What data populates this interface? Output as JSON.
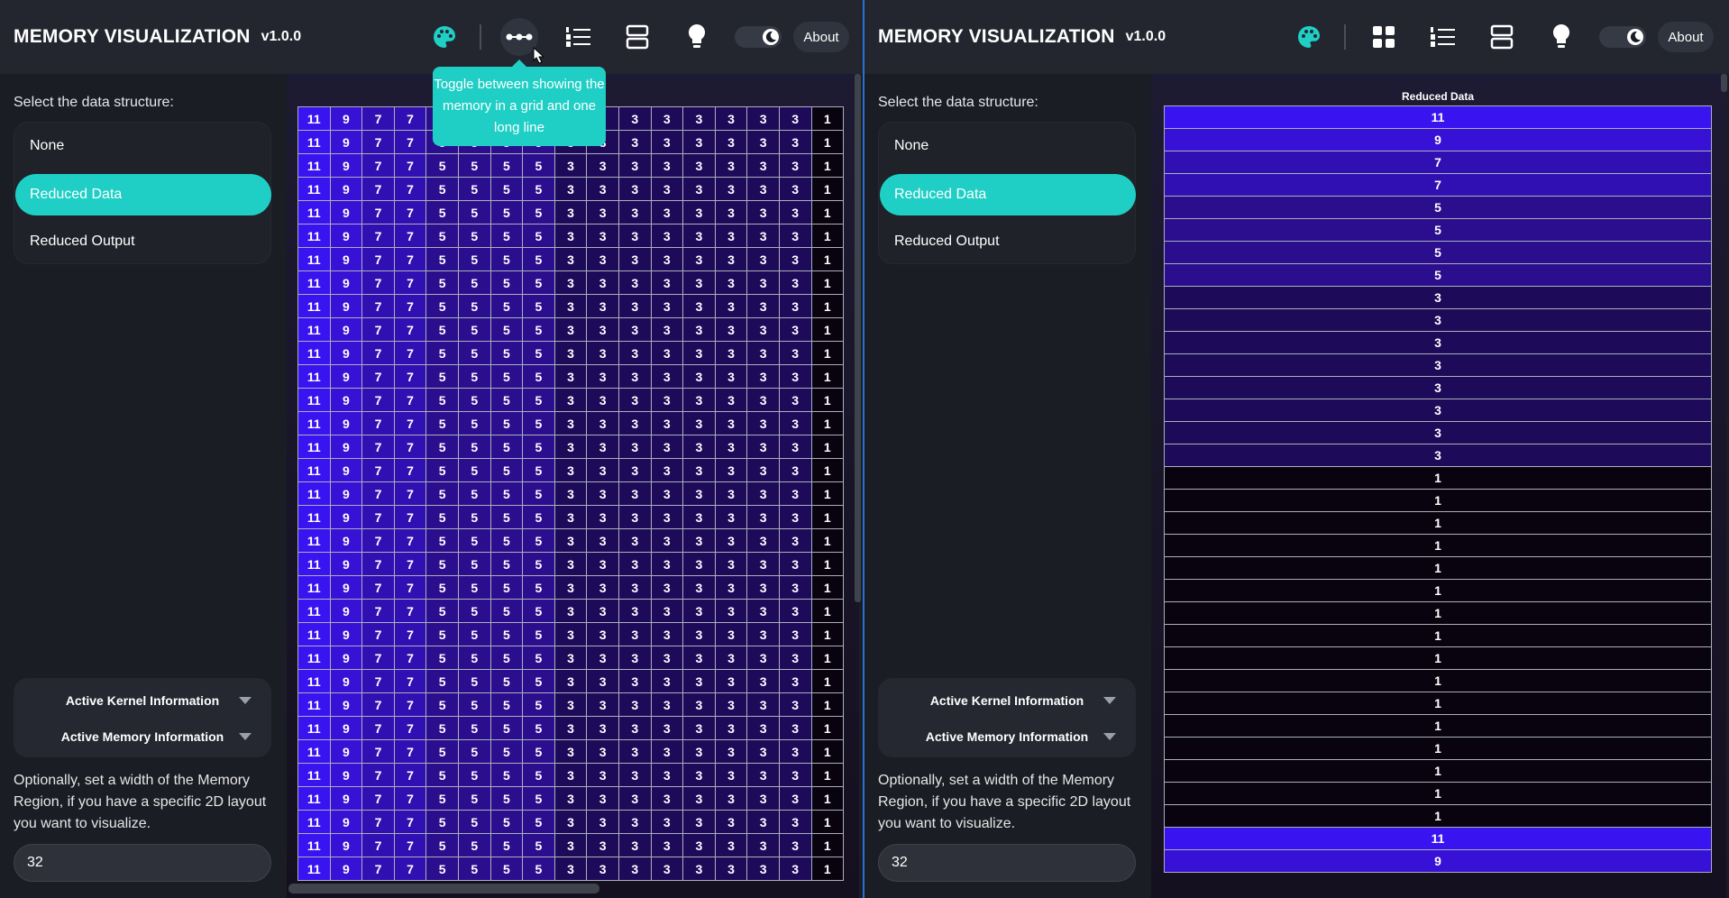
{
  "app": {
    "title": "MEMORY VISUALIZATION",
    "version": "v1.0.0"
  },
  "header": {
    "about_label": "About"
  },
  "sidebar": {
    "select_label": "Select the data structure:",
    "items": [
      {
        "label": "None",
        "selected": false
      },
      {
        "label": "Reduced Data",
        "selected": true
      },
      {
        "label": "Reduced Output",
        "selected": false
      }
    ],
    "kernel_info_label": "Active Kernel Information",
    "memory_info_label": "Active Memory Information",
    "width_text": "Optionally, set a width of the Memory Region, if you have a specific 2D layout you want to visualize.",
    "width_value": "32"
  },
  "tooltip": {
    "text": "Toggle between showing the memory in a grid and one long line"
  },
  "icons": {
    "palette": "palette-icon",
    "line_view": "horizontal-dots-icon",
    "grid_view": "grid-icon",
    "list": "numbered-list-icon",
    "stack": "stacked-panels-icon",
    "bulb": "lightbulb-icon",
    "moon": "moon-icon"
  },
  "colors": {
    "accent": "#1fcfc5",
    "header_bg": "#23262f",
    "page_bg": "#1b1d24",
    "cell_11": "#3a14f0",
    "cell_9": "#3811d6",
    "cell_7": "#3010b2",
    "cell_5": "#2a0e8e",
    "cell_3": "#1d0b5a",
    "cell_1": "#08030f"
  },
  "grid": {
    "row_values": [
      "11",
      "9",
      "7",
      "7",
      "5",
      "5",
      "5",
      "5",
      "3",
      "3",
      "3",
      "3",
      "3",
      "3",
      "3",
      "3",
      "1"
    ],
    "row_count": 33
  },
  "list_view": {
    "header": "Reduced Data",
    "values": [
      "11",
      "9",
      "7",
      "7",
      "5",
      "5",
      "5",
      "5",
      "3",
      "3",
      "3",
      "3",
      "3",
      "3",
      "3",
      "3",
      "1",
      "1",
      "1",
      "1",
      "1",
      "1",
      "1",
      "1",
      "1",
      "1",
      "1",
      "1",
      "1",
      "1",
      "1",
      "1",
      "11",
      "9"
    ]
  }
}
